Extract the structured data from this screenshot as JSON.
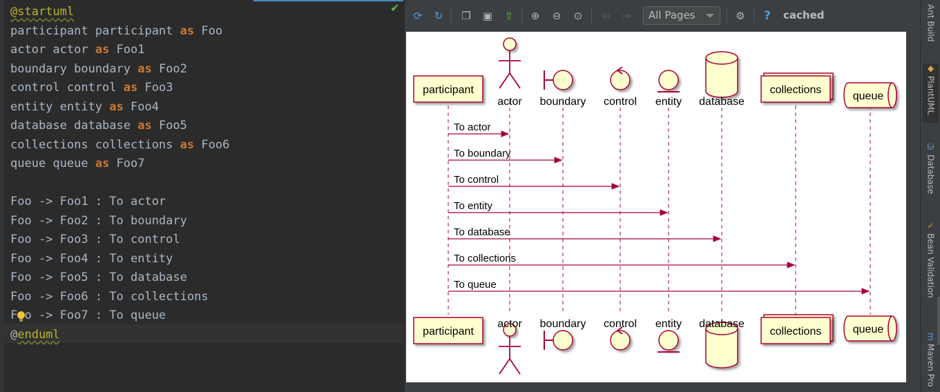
{
  "editor": {
    "lines": [
      [
        {
          "t": "@startuml",
          "c": "tag"
        }
      ],
      [
        {
          "t": "participant participant "
        },
        {
          "t": "as",
          "c": "kw"
        },
        {
          "t": " Foo"
        }
      ],
      [
        {
          "t": "actor actor "
        },
        {
          "t": "as",
          "c": "kw"
        },
        {
          "t": " Foo1"
        }
      ],
      [
        {
          "t": "boundary boundary "
        },
        {
          "t": "as",
          "c": "kw"
        },
        {
          "t": " Foo2"
        }
      ],
      [
        {
          "t": "control control "
        },
        {
          "t": "as",
          "c": "kw"
        },
        {
          "t": " Foo3"
        }
      ],
      [
        {
          "t": "entity entity "
        },
        {
          "t": "as",
          "c": "kw"
        },
        {
          "t": " Foo4"
        }
      ],
      [
        {
          "t": "database database "
        },
        {
          "t": "as",
          "c": "kw"
        },
        {
          "t": " Foo5"
        }
      ],
      [
        {
          "t": "collections collections "
        },
        {
          "t": "as",
          "c": "kw"
        },
        {
          "t": " Foo6"
        }
      ],
      [
        {
          "t": "queue queue "
        },
        {
          "t": "as",
          "c": "kw"
        },
        {
          "t": " Foo7"
        }
      ],
      [
        {
          "t": ""
        }
      ],
      [
        {
          "t": "Foo -> Foo1 : To actor"
        }
      ],
      [
        {
          "t": "Foo -> Foo2 : To boundary"
        }
      ],
      [
        {
          "t": "Foo -> Foo3 : To control"
        }
      ],
      [
        {
          "t": "Foo -> Foo4 : To entity"
        }
      ],
      [
        {
          "t": "Foo -> Foo5 : To database"
        }
      ],
      [
        {
          "t": "Foo -> Foo6 : To collections"
        }
      ],
      [
        {
          "t": "Foo -> Foo7 : To queue"
        }
      ],
      [
        {
          "t": "@"
        },
        {
          "t": "enduml",
          "c": "tag"
        }
      ]
    ]
  },
  "toolbar": {
    "pages_select": "All Pages",
    "cached": "cached",
    "icons": [
      "refresh-icon",
      "sync-icon",
      "copy-icon",
      "save-icon",
      "export-icon",
      "zoom-in-icon",
      "zoom-out-icon",
      "zoom-actual-icon",
      "prev-page-icon",
      "next-page-icon",
      "settings-icon",
      "help-icon"
    ]
  },
  "diagram": {
    "participants": [
      {
        "label": "participant",
        "kind": "participant"
      },
      {
        "label": "actor",
        "kind": "actor"
      },
      {
        "label": "boundary",
        "kind": "boundary"
      },
      {
        "label": "control",
        "kind": "control"
      },
      {
        "label": "entity",
        "kind": "entity"
      },
      {
        "label": "database",
        "kind": "database"
      },
      {
        "label": "collections",
        "kind": "collections"
      },
      {
        "label": "queue",
        "kind": "queue"
      }
    ],
    "messages": [
      {
        "text": "To actor",
        "to": 1
      },
      {
        "text": "To boundary",
        "to": 2
      },
      {
        "text": "To control",
        "to": 3
      },
      {
        "text": "To entity",
        "to": 4
      },
      {
        "text": "To database",
        "to": 5
      },
      {
        "text": "To collections",
        "to": 6
      },
      {
        "text": "To queue",
        "to": 7
      }
    ],
    "colors": {
      "fill": "#fefece",
      "stroke": "#a80036",
      "arrow": "#a80036"
    }
  },
  "right_sidebar": {
    "items": [
      "Ant Build",
      "PlantUML",
      "Database",
      "Bean Validation",
      "Maven Pro"
    ]
  }
}
